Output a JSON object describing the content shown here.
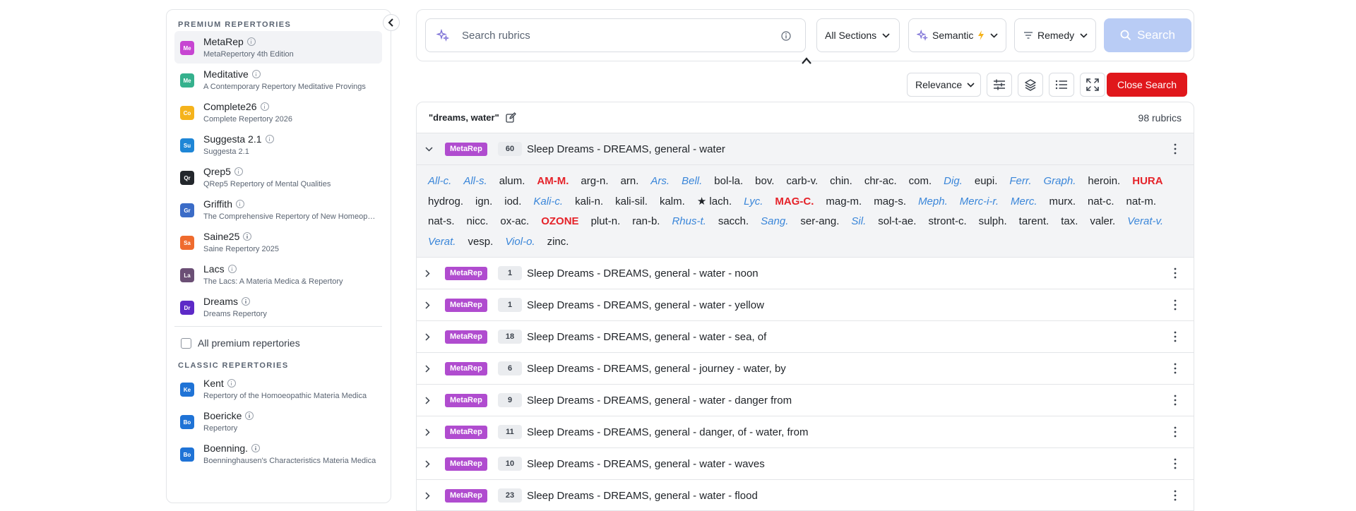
{
  "sidebar": {
    "premium_heading": "PREMIUM REPERTORIES",
    "premium": [
      {
        "badge": "Me",
        "color": "#c745d2",
        "name": "MetaRep",
        "desc": "MetaRepertory 4th Edition",
        "active": true
      },
      {
        "badge": "Me",
        "color": "#35b18d",
        "name": "Meditative",
        "desc": "A Contemporary Repertory Meditative Provings"
      },
      {
        "badge": "Co",
        "color": "#f5b31c",
        "name": "Complete26",
        "desc": "Complete Repertory 2026"
      },
      {
        "badge": "Su",
        "color": "#1f86d6",
        "name": "Suggesta 2.1",
        "desc": "Suggesta 2.1"
      },
      {
        "badge": "Qr",
        "color": "#23272c",
        "name": "Qrep5",
        "desc": "QRep5 Repertory of Mental Qualities"
      },
      {
        "badge": "Gr",
        "color": "#3b6cc7",
        "name": "Griffith",
        "desc": "The Comprehensive Repertory of New Homeopathic Remedies"
      },
      {
        "badge": "Sa",
        "color": "#ef6b2e",
        "name": "Saine25",
        "desc": "Saine Repertory 2025"
      },
      {
        "badge": "La",
        "color": "#6b4f75",
        "name": "Lacs",
        "desc": "The Lacs: A Materia Medica & Repertory"
      },
      {
        "badge": "Dr",
        "color": "#5d2ac7",
        "name": "Dreams",
        "desc": "Dreams Repertory"
      }
    ],
    "all_premium_label": "All premium repertories",
    "classic_heading": "CLASSIC REPERTORIES",
    "classic": [
      {
        "badge": "Ke",
        "color": "#1f73d6",
        "name": "Kent",
        "desc": "Repertory of the Homoeopathic Materia Medica"
      },
      {
        "badge": "Bo",
        "color": "#1f73d6",
        "name": "Boericke",
        "desc": "Repertory"
      },
      {
        "badge": "Bo",
        "color": "#1f73d6",
        "name": "Boenning.",
        "desc": "Boenninghausen's Characteristics Materia Medica"
      }
    ]
  },
  "search": {
    "placeholder": "Search rubrics",
    "sections_label": "All Sections",
    "semantic_label": "Semantic",
    "remedy_label": "Remedy",
    "button_label": "Search"
  },
  "toolbar": {
    "sort_label": "Relevance",
    "close_label": "Close Search"
  },
  "results": {
    "query": "\"dreams, water\"",
    "count": "98 rubrics",
    "rows": [
      {
        "tag": "MetaRep",
        "num": "60",
        "title": "Sleep Dreams - DREAMS, general - water",
        "expanded": true
      },
      {
        "tag": "MetaRep",
        "num": "1",
        "title": "Sleep Dreams - DREAMS, general - water - noon"
      },
      {
        "tag": "MetaRep",
        "num": "1",
        "title": "Sleep Dreams - DREAMS, general - water - yellow"
      },
      {
        "tag": "MetaRep",
        "num": "18",
        "title": "Sleep Dreams - DREAMS, general - water - sea, of"
      },
      {
        "tag": "MetaRep",
        "num": "6",
        "title": "Sleep Dreams - DREAMS, general - journey - water, by"
      },
      {
        "tag": "MetaRep",
        "num": "9",
        "title": "Sleep Dreams - DREAMS, general - water - danger from"
      },
      {
        "tag": "MetaRep",
        "num": "11",
        "title": "Sleep Dreams - DREAMS, general - danger, of - water, from"
      },
      {
        "tag": "MetaRep",
        "num": "10",
        "title": "Sleep Dreams - DREAMS, general - water - waves"
      },
      {
        "tag": "MetaRep",
        "num": "23",
        "title": "Sleep Dreams - DREAMS, general - water - flood"
      }
    ],
    "remedies": [
      {
        "t": "All-c.",
        "s": "it"
      },
      {
        "t": "All-s.",
        "s": "it"
      },
      {
        "t": "alum.",
        "s": ""
      },
      {
        "t": "AM-M.",
        "s": "bold"
      },
      {
        "t": "arg-n.",
        "s": ""
      },
      {
        "t": "arn.",
        "s": ""
      },
      {
        "t": "Ars.",
        "s": "it"
      },
      {
        "t": "Bell.",
        "s": "it"
      },
      {
        "t": "bol-la.",
        "s": ""
      },
      {
        "t": "bov.",
        "s": ""
      },
      {
        "t": "carb-v.",
        "s": ""
      },
      {
        "t": "chin.",
        "s": ""
      },
      {
        "t": "chr-ac.",
        "s": ""
      },
      {
        "t": "com.",
        "s": ""
      },
      {
        "t": "Dig.",
        "s": "it"
      },
      {
        "t": "eupi.",
        "s": ""
      },
      {
        "t": "Ferr.",
        "s": "it"
      },
      {
        "t": "Graph.",
        "s": "it"
      },
      {
        "t": "heroin.",
        "s": ""
      },
      {
        "t": "HURA",
        "s": "bold"
      },
      {
        "t": "hydrog.",
        "s": ""
      },
      {
        "t": "ign.",
        "s": ""
      },
      {
        "t": "iod.",
        "s": ""
      },
      {
        "t": "Kali-c.",
        "s": "it"
      },
      {
        "t": "kali-n.",
        "s": ""
      },
      {
        "t": "kali-sil.",
        "s": ""
      },
      {
        "t": "kalm.",
        "s": ""
      },
      {
        "t": "★ lach.",
        "s": ""
      },
      {
        "t": "Lyc.",
        "s": "it"
      },
      {
        "t": "MAG-C.",
        "s": "bold"
      },
      {
        "t": "mag-m.",
        "s": ""
      },
      {
        "t": "mag-s.",
        "s": ""
      },
      {
        "t": "Meph.",
        "s": "it"
      },
      {
        "t": "Merc-i-r.",
        "s": "it"
      },
      {
        "t": "Merc.",
        "s": "it"
      },
      {
        "t": "murx.",
        "s": ""
      },
      {
        "t": "nat-c.",
        "s": ""
      },
      {
        "t": "nat-m.",
        "s": ""
      },
      {
        "t": "nat-s.",
        "s": ""
      },
      {
        "t": "nicc.",
        "s": ""
      },
      {
        "t": "ox-ac.",
        "s": ""
      },
      {
        "t": "OZONE",
        "s": "bold"
      },
      {
        "t": "plut-n.",
        "s": ""
      },
      {
        "t": "ran-b.",
        "s": ""
      },
      {
        "t": "Rhus-t.",
        "s": "it"
      },
      {
        "t": "sacch.",
        "s": ""
      },
      {
        "t": "Sang.",
        "s": "it"
      },
      {
        "t": "ser-ang.",
        "s": ""
      },
      {
        "t": "Sil.",
        "s": "it"
      },
      {
        "t": "sol-t-ae.",
        "s": ""
      },
      {
        "t": "stront-c.",
        "s": ""
      },
      {
        "t": "sulph.",
        "s": ""
      },
      {
        "t": "tarent.",
        "s": ""
      },
      {
        "t": "tax.",
        "s": ""
      },
      {
        "t": "valer.",
        "s": ""
      },
      {
        "t": "Verat-v.",
        "s": "it"
      },
      {
        "t": "Verat.",
        "s": "it"
      },
      {
        "t": "vesp.",
        "s": ""
      },
      {
        "t": "Viol-o.",
        "s": "it"
      },
      {
        "t": "zinc.",
        "s": ""
      }
    ]
  },
  "colors": {
    "accent": "#e0171b",
    "tag": "#b04ccf",
    "search_btn": "#b9ccf5",
    "italic": "#3a86d9",
    "bold": "#e5232a"
  }
}
